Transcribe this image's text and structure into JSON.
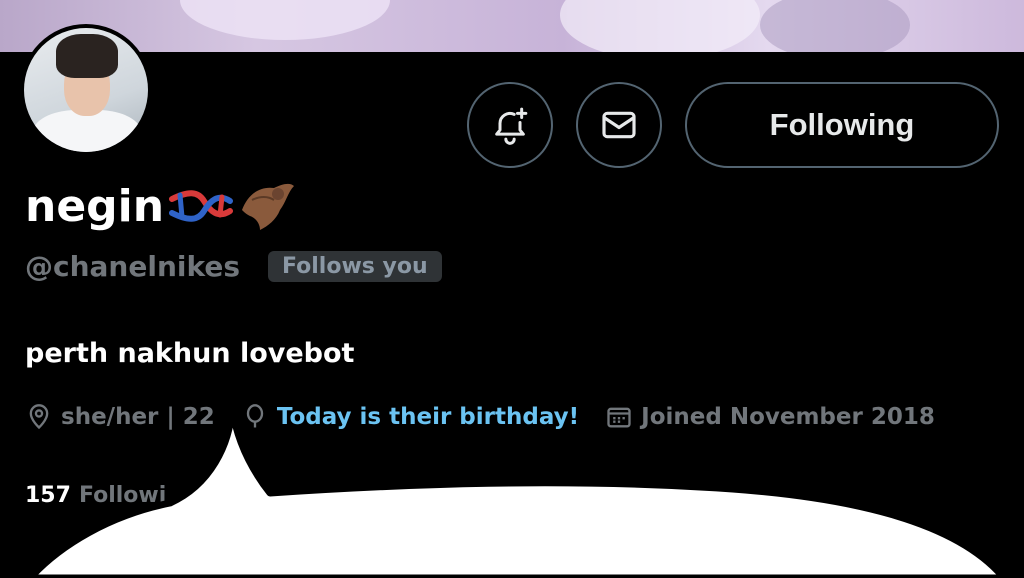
{
  "profile": {
    "display_name": "negin",
    "handle": "@chanelnikes",
    "follows_you_badge": "Follows you",
    "bio": "perth nakhun lovebot",
    "pronouns_age": "she/her | 22",
    "birthday_text": "Today is their birthday!",
    "joined": "Joined November 2018",
    "following_count": "157",
    "following_label": "Followi"
  },
  "actions": {
    "following_label": "Following",
    "notify_icon": "bell-plus-icon",
    "message_icon": "envelope-icon"
  },
  "colors": {
    "background": "#000000",
    "muted_text": "#71767b",
    "link_blue": "#6bc3f2",
    "button_border": "#536471"
  }
}
